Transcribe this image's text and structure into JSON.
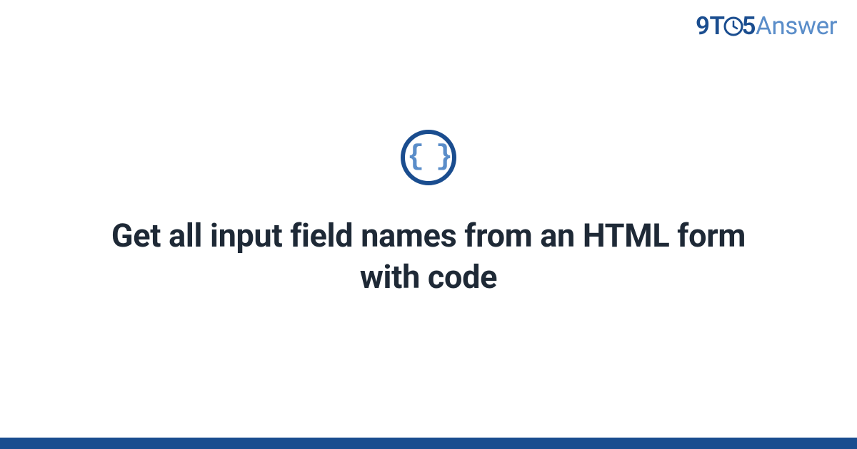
{
  "brand": {
    "part1": "9T",
    "part2": "5",
    "part3": "Answer"
  },
  "icon": {
    "braces": "{ }"
  },
  "title": "Get all input field names from an HTML form with code"
}
